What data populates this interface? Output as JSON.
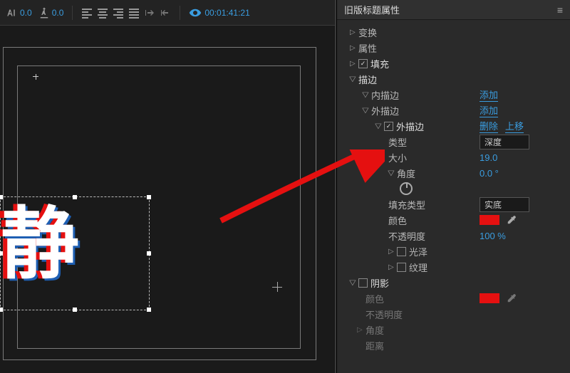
{
  "toolbar": {
    "va_value": "0.0",
    "ta_value": "0.0",
    "timecode": "00:01:41:21"
  },
  "canvas": {
    "title_text": "静"
  },
  "panel": {
    "title": "旧版标题属性",
    "groups": {
      "transform": "变换",
      "attributes": "属性",
      "fill": "填充",
      "stroke": "描边",
      "inner_stroke": "内描边",
      "outer_stroke": "外描边",
      "outer_stroke_enable": "外描边",
      "type": "类型",
      "size": "大小",
      "angle": "角度",
      "fill_type": "填充类型",
      "color": "颜色",
      "opacity": "不透明度",
      "sheen": "光泽",
      "texture": "纹理",
      "shadow": "阴影",
      "shadow_color": "颜色",
      "shadow_opacity": "不透明度",
      "shadow_angle": "角度",
      "distance": "距离"
    },
    "actions": {
      "add": "添加",
      "delete": "删除",
      "move_up": "上移"
    },
    "values": {
      "type_value": "深度",
      "size_value": "19.0",
      "angle_value": "0.0 °",
      "fill_type_value": "实底",
      "opacity_value": "100 %",
      "stroke_color": "#e51010",
      "shadow_color": "#e51010"
    }
  }
}
